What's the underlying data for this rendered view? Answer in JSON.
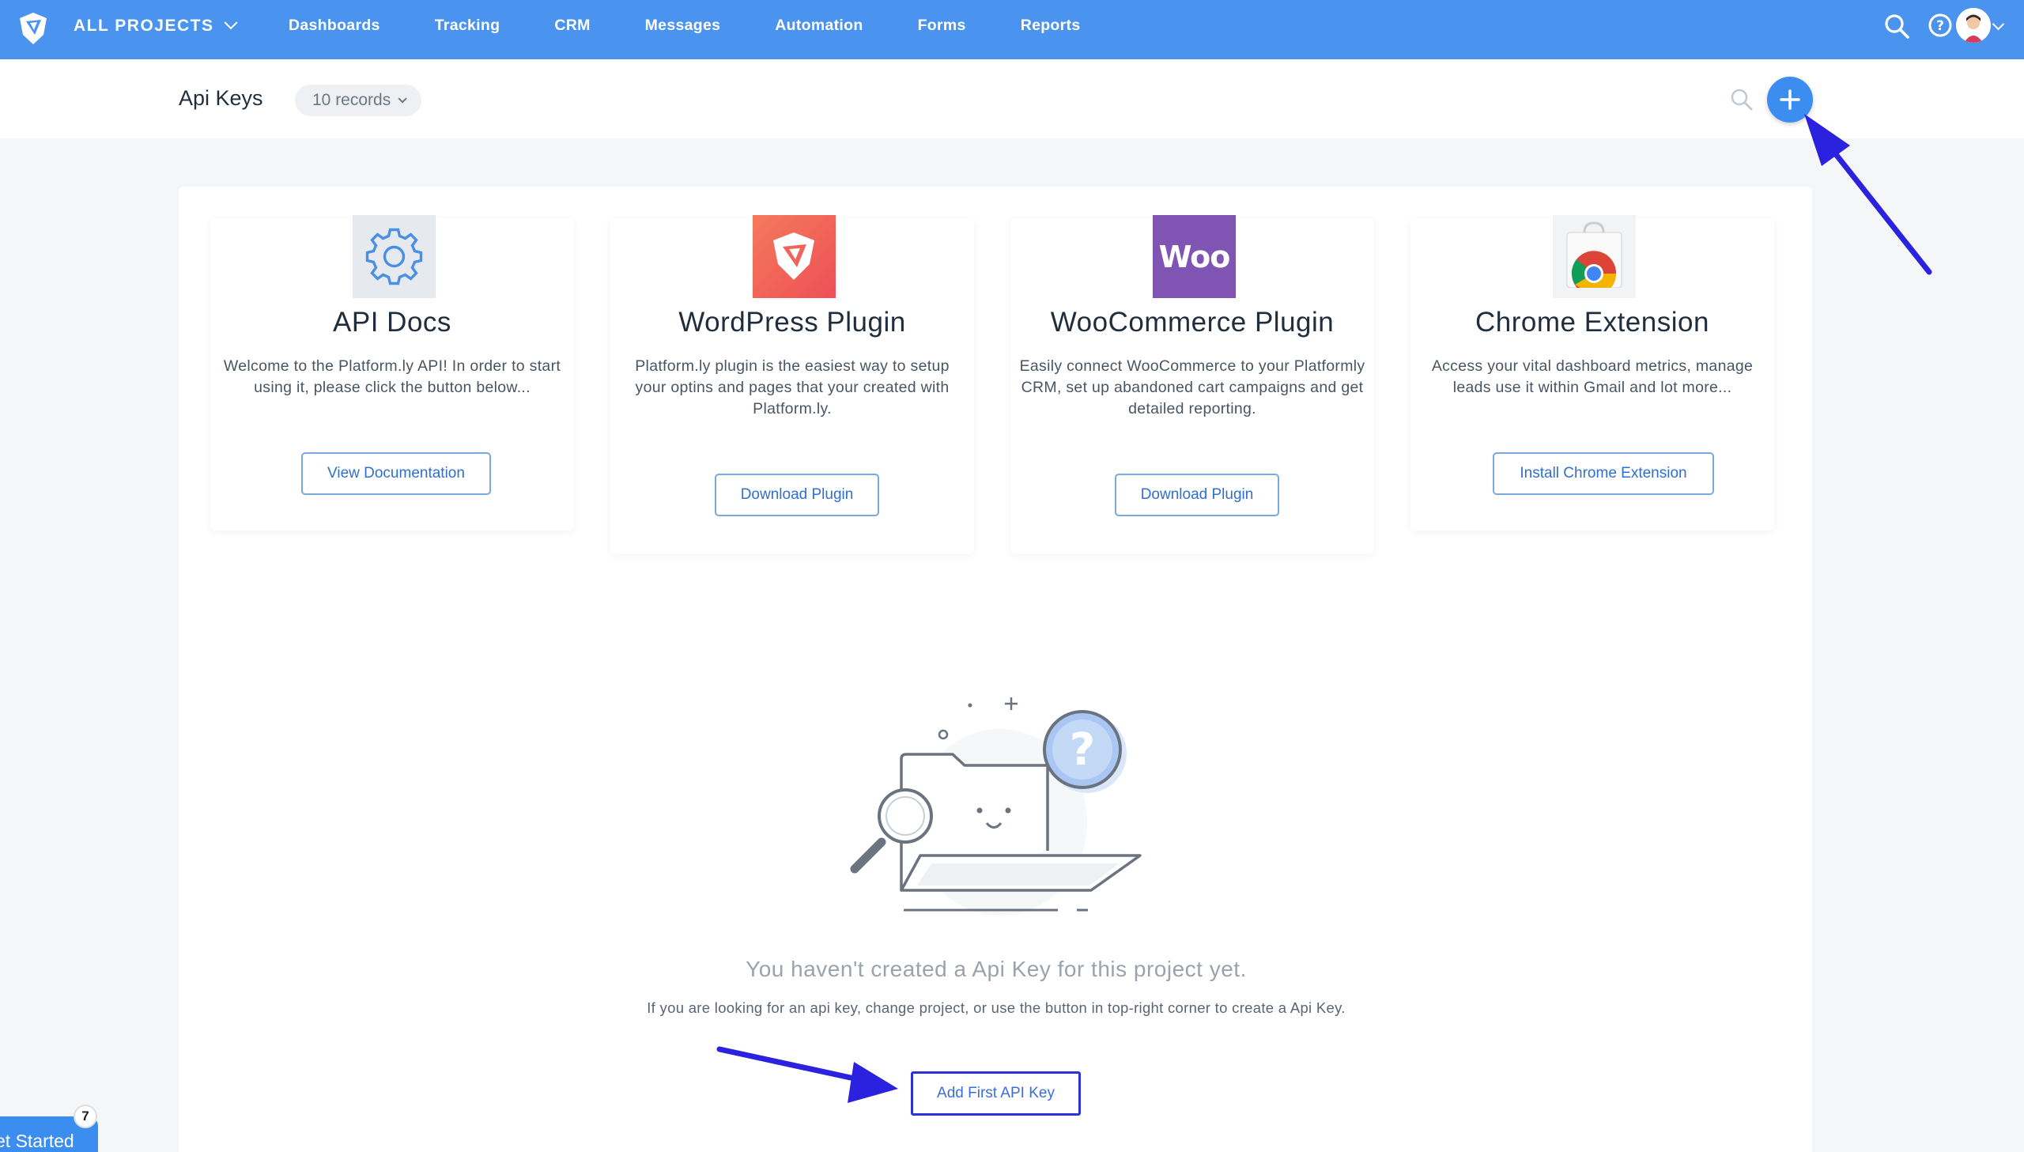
{
  "topnav": {
    "project_label": "ALL PROJECTS",
    "links": [
      "Dashboards",
      "Tracking",
      "CRM",
      "Messages",
      "Automation",
      "Forms",
      "Reports"
    ],
    "icons": [
      "search-icon",
      "help-icon",
      "avatar",
      "chevron-down-icon"
    ]
  },
  "header": {
    "title": "Api Keys",
    "records_label": "10 records"
  },
  "tools": [
    {
      "title": "API Docs",
      "description": "Welcome to the Platform.ly API! In order to start using it, please click the button below...",
      "button": "View Documentation",
      "icon": "gear-icon"
    },
    {
      "title": "WordPress Plugin",
      "description": "Platform.ly plugin is the easiest way to setup your optins and pages that your created with Platform.ly.",
      "button": "Download Plugin",
      "icon": "platformly-logo-icon"
    },
    {
      "title": "WooCommerce Plugin",
      "description": "Easily connect WooCommerce to your Platformly CRM, set up abandoned cart campaigns and get detailed reporting.",
      "button": "Download Plugin",
      "icon": "woo-logo-icon",
      "logo_text": "Woo"
    },
    {
      "title": "Chrome Extension",
      "description": "Access your vital dashboard metrics, manage leads use it within Gmail and lot more...",
      "button": "Install Chrome Extension",
      "icon": "chrome-store-icon"
    }
  ],
  "empty_state": {
    "title": "You haven't created a Api Key for this project yet.",
    "subtitle": "If you are looking for an api key, change project, or use the button in top-right corner to create a Api Key.",
    "button": "Add First API Key"
  },
  "get_started": {
    "label": "et Started",
    "badge": "7"
  },
  "colors": {
    "nav": "#4a94f0",
    "accent": "#3c8df0",
    "annotation_arrow": "#2b22e0",
    "woo": "#7f54b3",
    "wordpress_tile": "#f25c54"
  }
}
